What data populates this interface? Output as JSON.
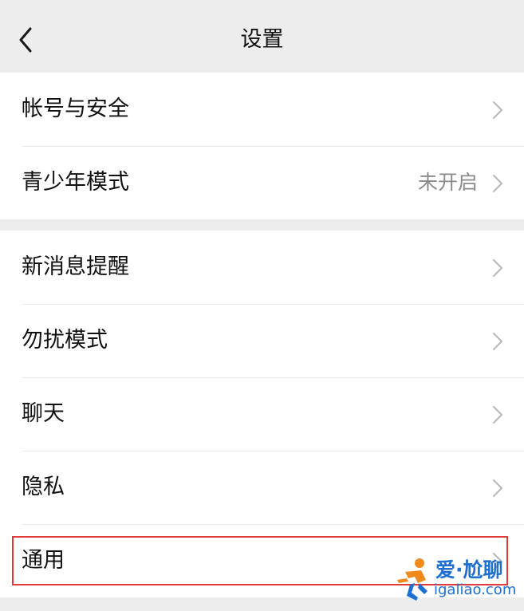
{
  "header": {
    "title": "设置"
  },
  "groups": [
    {
      "items": [
        {
          "label": "帐号与安全",
          "value": ""
        },
        {
          "label": "青少年模式",
          "value": "未开启"
        }
      ]
    },
    {
      "items": [
        {
          "label": "新消息提醒",
          "value": ""
        },
        {
          "label": "勿扰模式",
          "value": ""
        },
        {
          "label": "聊天",
          "value": ""
        },
        {
          "label": "隐私",
          "value": ""
        },
        {
          "label": "通用",
          "value": ""
        }
      ]
    }
  ],
  "watermark": {
    "brand": "爱·尬聊",
    "site": "igaliao.com"
  },
  "colors": {
    "background": "#ededed",
    "highlight_border": "#e03a3a",
    "watermark_blue": "#1d6fd1"
  }
}
